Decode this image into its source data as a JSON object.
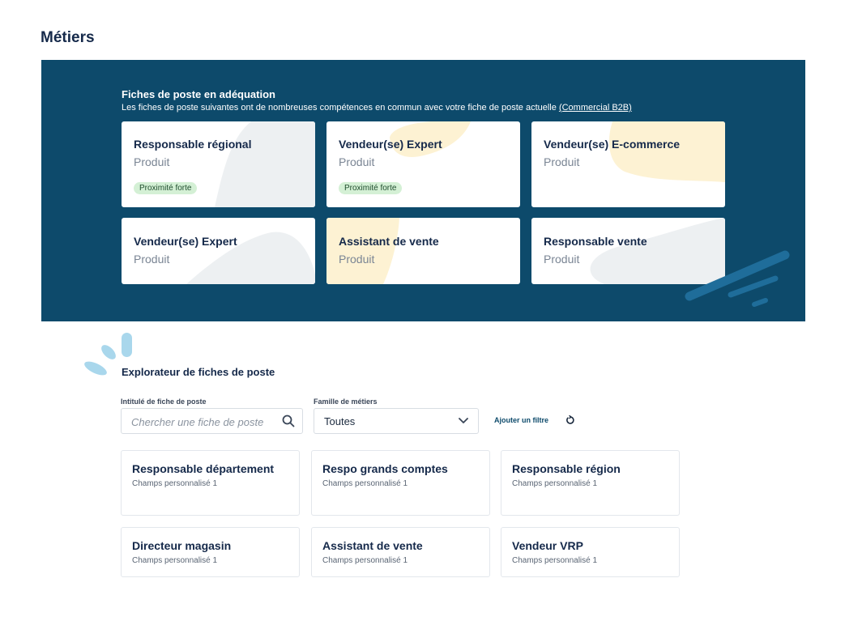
{
  "page": {
    "title": "Métiers"
  },
  "banner": {
    "title": "Fiches de poste en adéquation",
    "subtitle": "Les fiches de poste suivantes ont de nombreuses compétences en commun avec votre fiche de poste actuelle",
    "current_job_link": "(Commercial B2B)",
    "bg_color": "#0d4a6b",
    "cards": [
      {
        "title": "Responsable régional",
        "subtitle": "Produit",
        "badge": "Proximité forte"
      },
      {
        "title": "Vendeur(se) Expert",
        "subtitle": "Produit",
        "badge": "Proximité forte"
      },
      {
        "title": "Vendeur(se) E-commerce",
        "subtitle": "Produit"
      },
      {
        "title": "Vendeur(se) Expert",
        "subtitle": "Produit"
      },
      {
        "title": "Assistant de vente",
        "subtitle": "Produit"
      },
      {
        "title": "Responsable vente",
        "subtitle": "Produit"
      }
    ]
  },
  "explorer": {
    "title": "Explorateur de fiches de poste",
    "search": {
      "label": "Intitulé de fiche de poste",
      "placeholder": "Chercher une fiche de poste",
      "icon": "search-icon"
    },
    "family": {
      "label": "Famille de métiers",
      "value": "Toutes",
      "icon": "chevron-down-icon"
    },
    "add_filter": "Ajouter un filtre",
    "reset_icon": "reset-icon",
    "cards": [
      {
        "title": "Responsable département",
        "subtitle": "Champs personnalisé 1"
      },
      {
        "title": "Respo grands comptes",
        "subtitle": "Champs personnalisé 1"
      },
      {
        "title": "Responsable région",
        "subtitle": "Champs personnalisé 1"
      },
      {
        "title": "Directeur magasin",
        "subtitle": "Champs personnalisé 1"
      },
      {
        "title": "Assistant de vente",
        "subtitle": "Champs personnalisé 1"
      },
      {
        "title": "Vendeur VRP",
        "subtitle": "Champs personnalisé 1"
      }
    ]
  },
  "colors": {
    "accent": "#0d4a6b",
    "badge_bg": "#d4f0d5",
    "deco_grey": "#edf0f2",
    "deco_yellow": "#fdf2d3",
    "deco_blue": "#a9d7ec"
  }
}
